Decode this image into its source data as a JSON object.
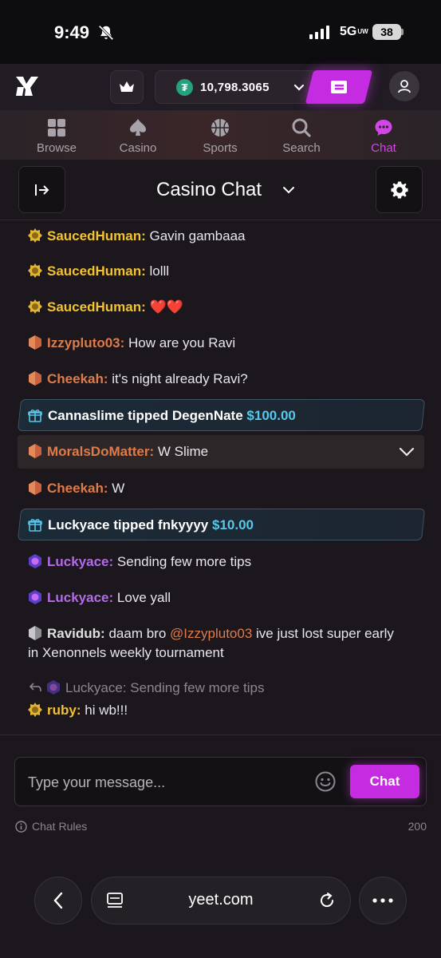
{
  "status_bar": {
    "time": "9:49",
    "network": "5G",
    "network_sub": "UW",
    "battery": "38"
  },
  "header": {
    "balance": "10,798.3065",
    "currency_symbol": "₮"
  },
  "nav": {
    "tabs": [
      {
        "label": "Browse",
        "icon": "grid-icon"
      },
      {
        "label": "Casino",
        "icon": "spade-icon"
      },
      {
        "label": "Sports",
        "icon": "basketball-icon"
      },
      {
        "label": "Search",
        "icon": "search-icon"
      },
      {
        "label": "Chat",
        "icon": "chat-bubble-icon",
        "active": true
      }
    ]
  },
  "chat": {
    "title": "Casino Chat"
  },
  "messages": [
    {
      "user": "SaucedHuman:",
      "text": "Gavin gambaaa",
      "tier": "gold"
    },
    {
      "user": "SaucedHuman:",
      "text": "lolll",
      "tier": "gold"
    },
    {
      "user": "SaucedHuman:",
      "text": "❤️❤️",
      "tier": "gold"
    },
    {
      "user": "Izzypluto03:",
      "text": "How are you Ravi",
      "tier": "bronze"
    },
    {
      "user": "Cheekah:",
      "text": "it's night already Ravi?",
      "tier": "bronze"
    },
    {
      "tip_text": "Cannaslime tipped DegenNate",
      "tip_amount": "$100.00"
    },
    {
      "user": "MoralsDoMatter:",
      "text": "W Slime",
      "tier": "bronze"
    },
    {
      "user": "Cheekah:",
      "text": "W",
      "tier": "bronze"
    },
    {
      "tip_text": "Luckyace tipped fnkyyyy",
      "tip_amount": "$10.00"
    },
    {
      "user": "Luckyace:",
      "text": "Sending few more tips",
      "tier": "purple"
    },
    {
      "user": "Luckyace:",
      "text": "Love yall",
      "tier": "purple"
    },
    {
      "user": "Ravidub:",
      "text_before": "daam bro",
      "mention": "@Izzypluto03",
      "text_after": "ive just lost super early",
      "text_line2": "in Xenonnels weekly tournament",
      "tier": "silver"
    },
    {
      "reply_user": "Luckyace:",
      "reply_text": "Sending few more tips"
    },
    {
      "user": "ruby:",
      "text": "hi wb!!!",
      "tier": "gold"
    }
  ],
  "composer": {
    "placeholder": "Type your message...",
    "send_label": "Chat",
    "rules_label": "Chat Rules",
    "char_limit": "200"
  },
  "browser": {
    "url": "yeet.com"
  },
  "colors": {
    "accent": "#c52be0",
    "gold": "#f2c230",
    "bronze": "#de7b4a",
    "purple": "#b36ce8",
    "tip_amount": "#57c7ea"
  }
}
